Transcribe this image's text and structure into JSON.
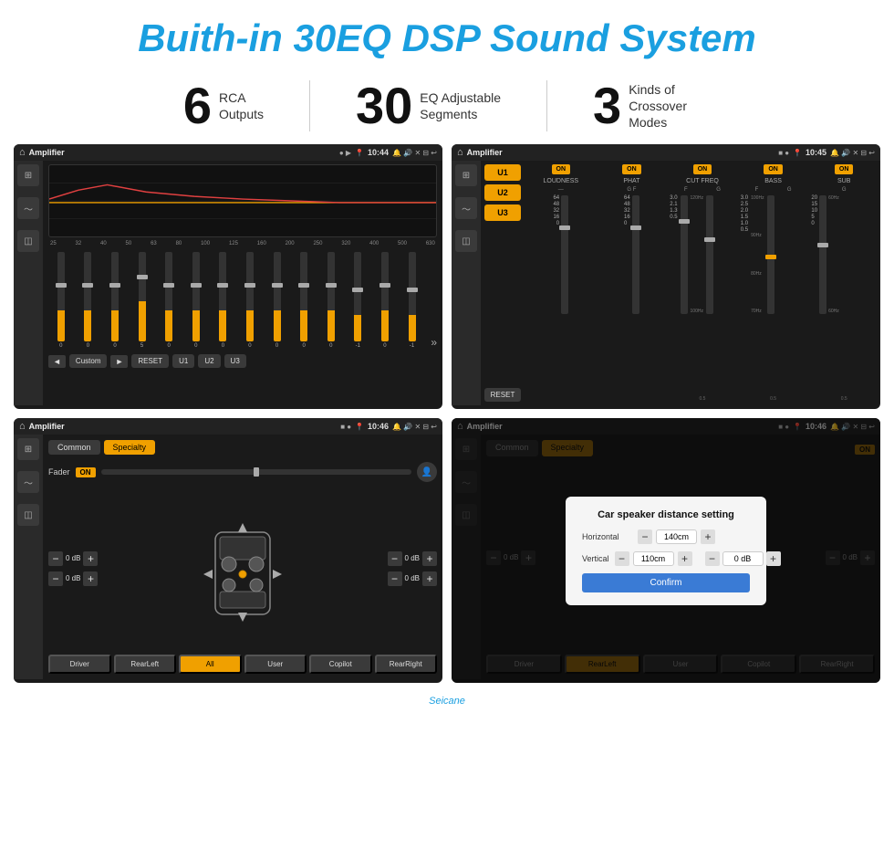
{
  "header": {
    "title": "Buith-in 30EQ DSP Sound System"
  },
  "stats": [
    {
      "number": "6",
      "label_line1": "RCA",
      "label_line2": "Outputs"
    },
    {
      "number": "30",
      "label_line1": "EQ Adjustable",
      "label_line2": "Segments"
    },
    {
      "number": "3",
      "label_line1": "Kinds of",
      "label_line2": "Crossover Modes"
    }
  ],
  "screen_tl": {
    "app_name": "Amplifier",
    "time": "10:44",
    "freq_labels": [
      "25",
      "32",
      "40",
      "50",
      "63",
      "80",
      "100",
      "125",
      "160",
      "200",
      "250",
      "320",
      "400",
      "500",
      "630"
    ],
    "slider_values": [
      "0",
      "0",
      "0",
      "5",
      "0",
      "0",
      "0",
      "0",
      "0",
      "0",
      "0",
      "-1",
      "0",
      "-1"
    ],
    "controls": {
      "prev": "◄",
      "label": "Custom",
      "next": "►",
      "reset": "RESET",
      "u1": "U1",
      "u2": "U2",
      "u3": "U3"
    }
  },
  "screen_tr": {
    "app_name": "Amplifier",
    "time": "10:45",
    "channels": [
      {
        "name": "LOUDNESS",
        "on": "ON"
      },
      {
        "name": "PHAT",
        "on": "ON"
      },
      {
        "name": "CUT FREQ",
        "on": "ON"
      },
      {
        "name": "BASS",
        "on": "ON"
      },
      {
        "name": "SUB",
        "on": "ON"
      }
    ],
    "u_buttons": [
      "U1",
      "U2",
      "U3"
    ],
    "reset": "RESET"
  },
  "screen_bl": {
    "app_name": "Amplifier",
    "time": "10:46",
    "tabs": [
      "Common",
      "Specialty"
    ],
    "fader_label": "Fader",
    "fader_on": "ON",
    "db_values": [
      "0 dB",
      "0 dB",
      "0 dB",
      "0 dB"
    ],
    "bottom_btns": [
      "Driver",
      "RearLeft",
      "All",
      "User",
      "Copilot",
      "RearRight"
    ]
  },
  "screen_br": {
    "app_name": "Amplifier",
    "time": "10:46",
    "tabs": [
      "Common",
      "Specialty"
    ],
    "fader_on": "ON",
    "dialog": {
      "title": "Car speaker distance setting",
      "horizontal_label": "Horizontal",
      "horizontal_value": "140cm",
      "vertical_label": "Vertical",
      "vertical_value": "110cm",
      "db_label": "0 dB",
      "confirm_label": "Confirm"
    },
    "bottom_btns": [
      "Driver",
      "RearLeft",
      "All",
      "User",
      "Copilot",
      "RearRight"
    ]
  },
  "watermark": "Seicane"
}
